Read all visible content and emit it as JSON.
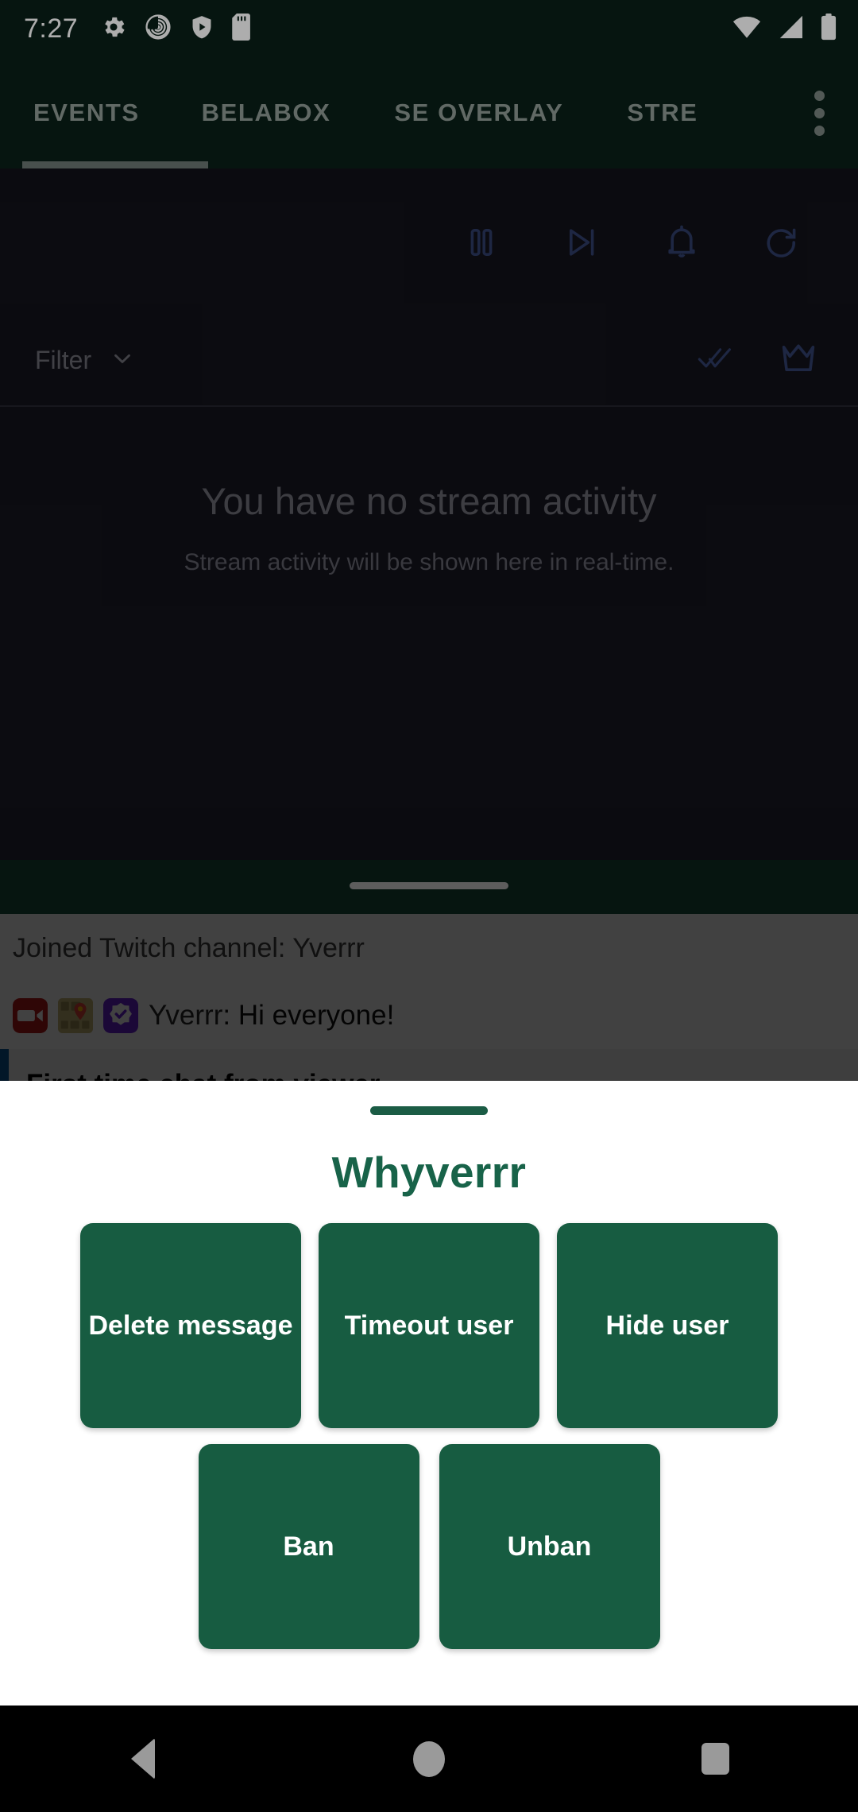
{
  "status_bar": {
    "clock": "7:27",
    "left_icons": [
      "gear-icon",
      "spiral-icon",
      "shield-play-icon",
      "sd-card-icon"
    ],
    "right_icons": [
      "wifi-icon",
      "cell-signal-icon",
      "battery-icon"
    ]
  },
  "tabs": {
    "items": [
      {
        "label": "EVENTS",
        "active": true
      },
      {
        "label": "BELABOX",
        "active": false
      },
      {
        "label": "SE OVERLAY",
        "active": false
      },
      {
        "label": "STRE",
        "active": false
      }
    ],
    "overflow_icon": "more-vertical-icon"
  },
  "events_panel": {
    "controls": [
      "pause-icon",
      "skip-next-icon",
      "bell-icon",
      "replay-icon"
    ],
    "filter": {
      "label": "Filter",
      "chevron_icon": "chevron-down-icon",
      "actions": [
        "double-check-icon",
        "crown-icon"
      ]
    },
    "empty_state": {
      "title": "You have no stream activity",
      "subtitle": "Stream activity will be shown here in real-time."
    }
  },
  "chat_panel": {
    "system_message": "Joined Twitch channel: Yverrr",
    "message": {
      "badges": [
        "broadcaster-camera-badge",
        "local-guide-badge",
        "verified-check-badge"
      ],
      "username": "Yverrr",
      "separator": ": ",
      "text": "Hi everyone!"
    },
    "event": {
      "text": "First time chat from viewer",
      "accent_color": "#0d5c9e"
    }
  },
  "bottom_sheet": {
    "title": "Whyverrr",
    "handle": "drag-handle",
    "buttons_row_1": [
      {
        "label": "Delete message"
      },
      {
        "label": "Timeout user"
      },
      {
        "label": "Hide user"
      }
    ],
    "buttons_row_2": [
      {
        "label": "Ban"
      },
      {
        "label": "Unban"
      }
    ],
    "button_color": "#175c41",
    "title_color": "#186349"
  },
  "nav_bar": {
    "back": "back-triangle-icon",
    "home": "home-circle-icon",
    "recents": "recents-square-icon"
  }
}
